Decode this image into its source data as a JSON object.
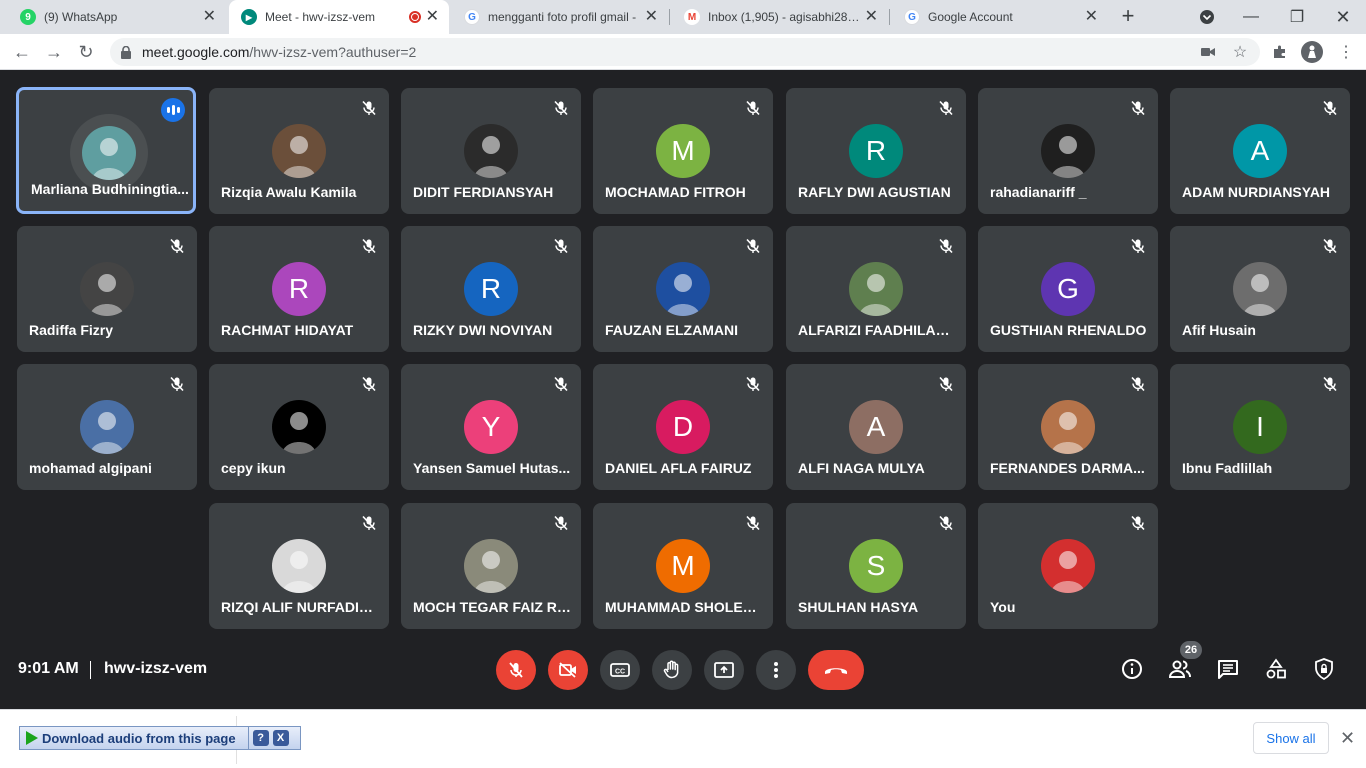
{
  "browser": {
    "tabs": [
      {
        "label": "(9) WhatsApp",
        "icon": "whatsapp-icon",
        "color": "#25d366",
        "glyph": "9"
      },
      {
        "label": "Meet - hwv-izsz-vem",
        "icon": "google-meet-icon",
        "color": "#00897b",
        "glyph": "▶"
      },
      {
        "label": "mengganti foto profil gmail -",
        "icon": "google-icon",
        "color": "#4285f4",
        "glyph": "G"
      },
      {
        "label": "Inbox (1,905) - agisabhi28@...",
        "icon": "gmail-icon",
        "color": "#ea4335",
        "glyph": "M"
      },
      {
        "label": "Google Account",
        "icon": "google-icon",
        "color": "#4285f4",
        "glyph": "G"
      }
    ],
    "url_host": "meet.google.com",
    "url_path": "/hwv-izsz-vem?authuser=2"
  },
  "participants": [
    {
      "name": "Marliana Budhiningtia...",
      "initial": "",
      "color": "#5f9ea0",
      "photo": true,
      "speaking": true
    },
    {
      "name": "Rizqia Awalu Kamila",
      "initial": "",
      "color": "#6b4f3a",
      "photo": true
    },
    {
      "name": "DIDIT FERDIANSYAH",
      "initial": "",
      "color": "#2b2b2b",
      "photo": true
    },
    {
      "name": "MOCHAMAD FITROH",
      "initial": "M",
      "color": "#7cb342"
    },
    {
      "name": "RAFLY DWI AGUSTIAN",
      "initial": "R",
      "color": "#00897b"
    },
    {
      "name": "rahadianariff _",
      "initial": "",
      "color": "#1f1f1f",
      "photo": true
    },
    {
      "name": "ADAM NURDIANSYAH",
      "initial": "A",
      "color": "#0097a7"
    },
    {
      "name": "Radiffa Fizry",
      "initial": "",
      "color": "#444444",
      "photo": true
    },
    {
      "name": "RACHMAT HIDAYAT",
      "initial": "R",
      "color": "#ab47bc"
    },
    {
      "name": "RIZKY DWI NOVIYAN",
      "initial": "R",
      "color": "#1565c0"
    },
    {
      "name": "FAUZAN ELZAMANI",
      "initial": "",
      "color": "#1e4fa0",
      "photo": true
    },
    {
      "name": "ALFARIZI FAADHILAH ...",
      "initial": "",
      "color": "#5f7f4f",
      "photo": true
    },
    {
      "name": "GUSTHIAN RHENALDO",
      "initial": "G",
      "color": "#5e35b1"
    },
    {
      "name": "Afif Husain",
      "initial": "",
      "color": "#6d6d6d",
      "photo": true
    },
    {
      "name": "mohamad algipani",
      "initial": "",
      "color": "#4a6fa5",
      "photo": true
    },
    {
      "name": "cepy ikun",
      "initial": "",
      "color": "#000000",
      "photo": true
    },
    {
      "name": "Yansen Samuel Hutas...",
      "initial": "Y",
      "color": "#ec407a"
    },
    {
      "name": "DANIEL AFLA FAIRUZ",
      "initial": "D",
      "color": "#d81b60"
    },
    {
      "name": "ALFI NAGA MULYA",
      "initial": "A",
      "color": "#8d6e63"
    },
    {
      "name": "FERNANDES DARMA...",
      "initial": "",
      "color": "#b5734a",
      "photo": true
    },
    {
      "name": "Ibnu Fadlillah",
      "initial": "I",
      "color": "#33691e"
    },
    {
      "name": "RIZQI ALIF NURFADILL...",
      "initial": "",
      "color": "#d9d9d9",
      "photo": true
    },
    {
      "name": "MOCH TEGAR FAIZ RI...",
      "initial": "",
      "color": "#8a8a7a",
      "photo": true
    },
    {
      "name": "MUHAMMAD SHOLEH...",
      "initial": "M",
      "color": "#ef6c00"
    },
    {
      "name": "SHULHAN HASYA",
      "initial": "S",
      "color": "#7cb342"
    },
    {
      "name": "You",
      "initial": "",
      "color": "#d32f2f",
      "photo": true
    }
  ],
  "meeting": {
    "time": "9:01 AM",
    "code": "hwv-izsz-vem",
    "participant_count": "26"
  },
  "download_shelf": {
    "extension_label": "Download audio from this page",
    "help": "?",
    "close": "X",
    "show_all": "Show all"
  }
}
